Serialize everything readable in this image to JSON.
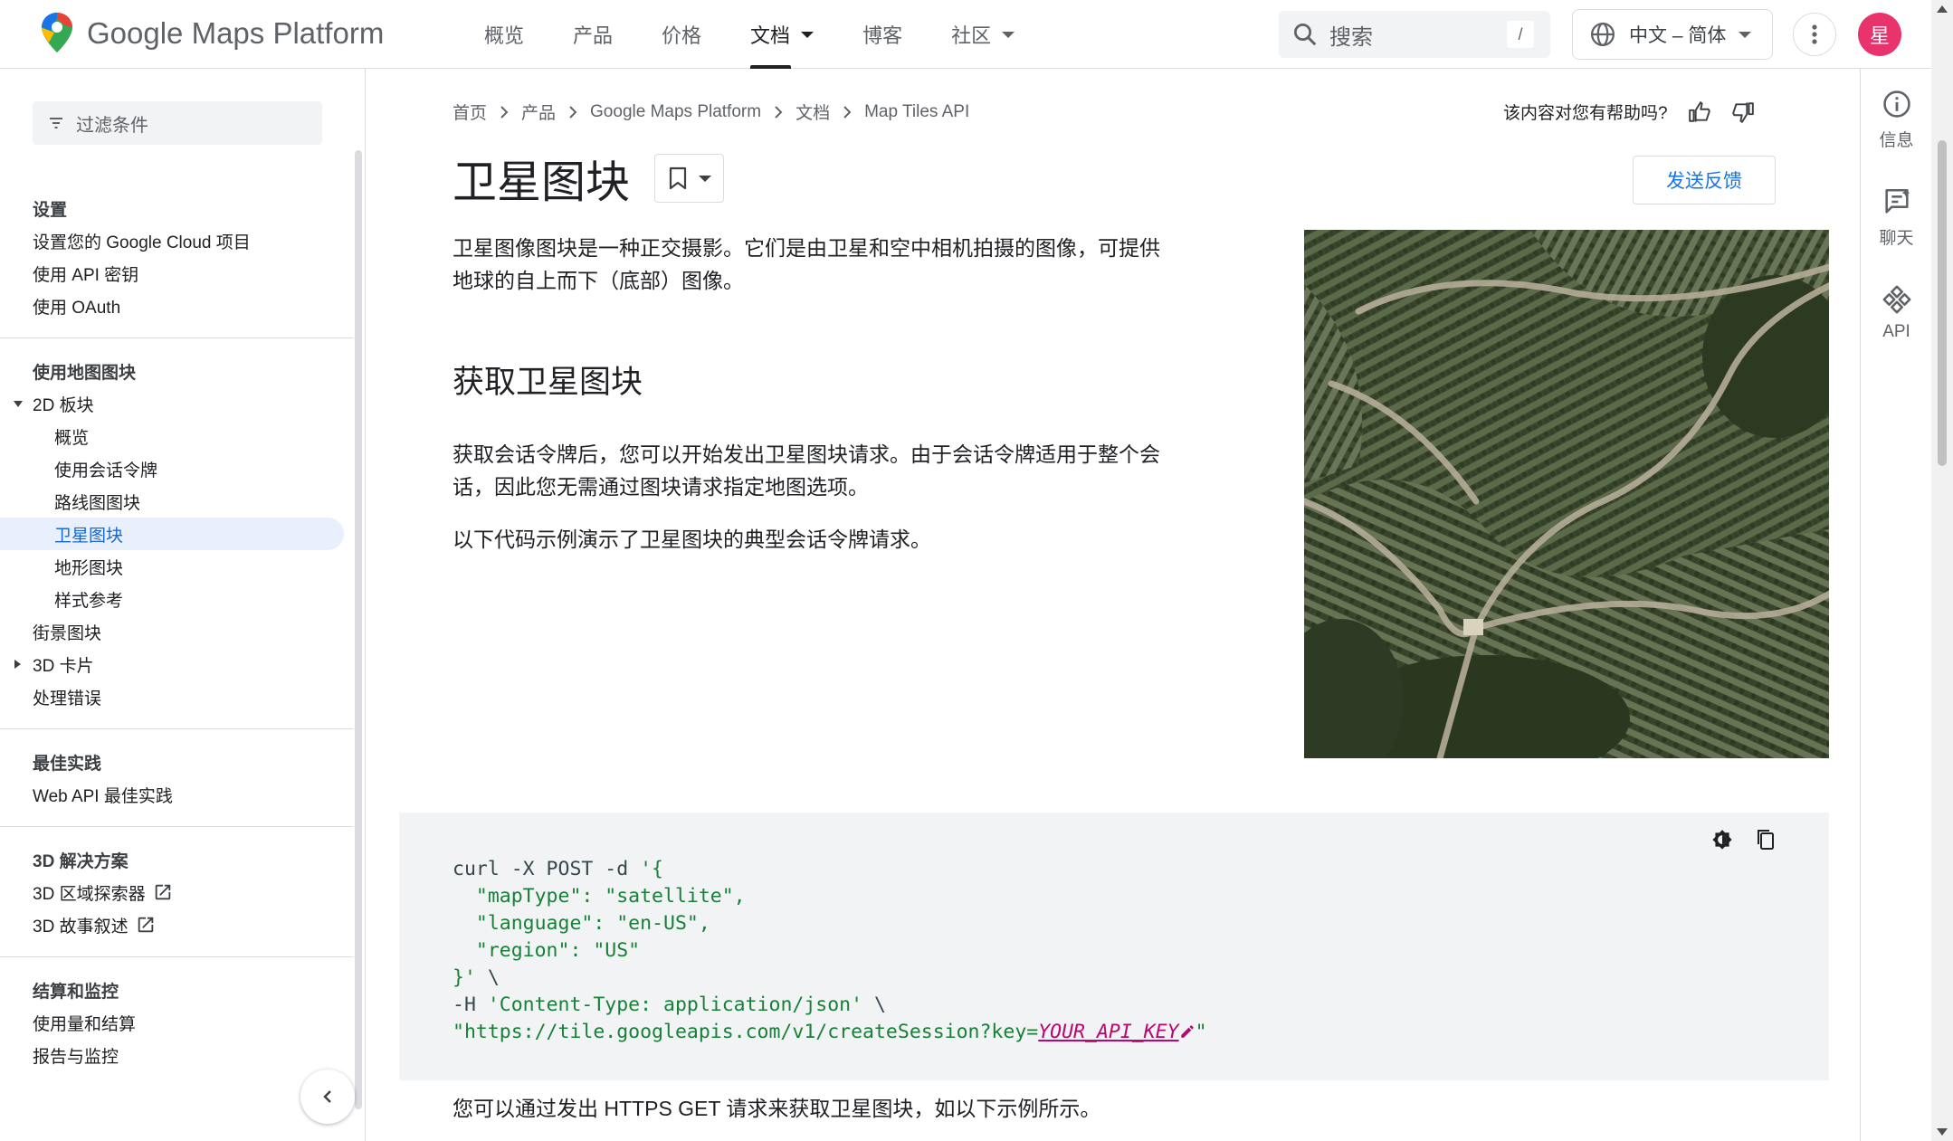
{
  "header": {
    "brand": "Google Maps Platform",
    "nav": [
      {
        "label": "概览"
      },
      {
        "label": "产品"
      },
      {
        "label": "价格"
      },
      {
        "label": "文档"
      },
      {
        "label": "博客"
      },
      {
        "label": "社区"
      }
    ],
    "search": {
      "placeholder": "搜索",
      "shortcut": "/"
    },
    "language": "中文 – 简体",
    "avatar_initial": "星"
  },
  "sidebar": {
    "filter_placeholder": "过滤条件",
    "section_setup": {
      "heading": "设置",
      "items": [
        "设置您的 Google Cloud 项目",
        "使用 API 密钥",
        "使用 OAuth"
      ]
    },
    "section_tiles": {
      "heading": "使用地图图块",
      "group_2d": "2D 板块",
      "sub_items": [
        "概览",
        "使用会话令牌",
        "路线图图块",
        "卫星图块",
        "地形图块",
        "样式参考"
      ],
      "items_after": [
        "街景图块"
      ],
      "group_3d": "3D 卡片",
      "last_item": "处理错误"
    },
    "section_best": {
      "heading": "最佳实践",
      "items": [
        "Web API 最佳实践"
      ]
    },
    "section_3d": {
      "heading": "3D 解决方案",
      "items": [
        "3D 区域探索器",
        "3D 故事叙述"
      ]
    },
    "section_billing": {
      "heading": "结算和监控",
      "items": [
        "使用量和结算",
        "报告与监控"
      ]
    }
  },
  "breadcrumb": [
    "首页",
    "产品",
    "Google Maps Platform",
    "文档",
    "Map Tiles API"
  ],
  "helpful_prompt": "该内容对您有帮助吗?",
  "page": {
    "title": "卫星图块",
    "feedback_label": "发送反馈",
    "intro_line1": "卫星图像图块是一种正交摄影。它们是由卫星和空中相机拍摄的图像，可提供",
    "intro_line2": "地球的自上而下（底部）图像。",
    "section_heading": "获取卫星图块",
    "para2_line1": "获取会话令牌后，您可以开始发出卫星图块请求。由于会话令牌适用于整个会",
    "para2_line2": "话，因此您无需通过图块请求指定地图选项。",
    "para3": "以下代码示例演示了卫星图块的典型会话令牌请求。",
    "code": {
      "line1_plain": "curl -X POST -d ",
      "line1_str": "'{",
      "line2": "  \"mapType\": \"satellite\",",
      "line3": "  \"language\": \"en-US\",",
      "line4": "  \"region\": \"US\"",
      "line5": "}'",
      "line5_tail": " \\",
      "line6_plain": "-H ",
      "line6_str": "'Content-Type: application/json'",
      "line6_tail": " \\",
      "line7_str": "\"https://tile.googleapis.com/v1/createSession?key=",
      "line7_key": "YOUR_API_KEY",
      "line7_end": "\""
    },
    "bottom_text": "您可以通过发出 HTTPS GET 请求来获取卫星图块，如以下示例所示。"
  },
  "right_rail": [
    {
      "label": "信息",
      "icon": "info-icon"
    },
    {
      "label": "聊天",
      "icon": "chat-icon"
    },
    {
      "label": "API",
      "icon": "api-icon"
    }
  ],
  "colors": {
    "accent": "#1a73e8",
    "active_bg": "#e8f0fe",
    "avatar": "#e8336d"
  }
}
